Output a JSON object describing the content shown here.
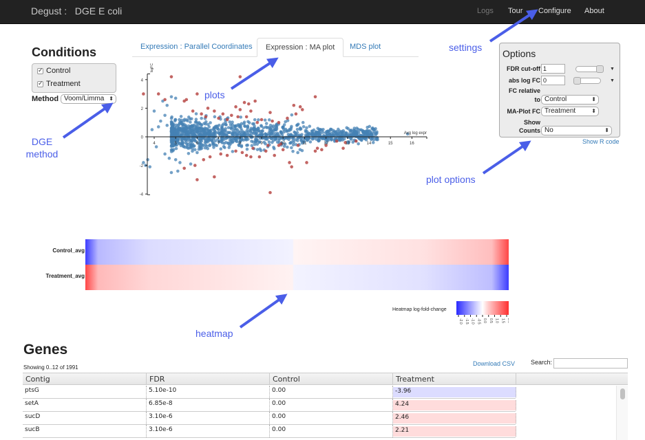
{
  "navbar": {
    "brand": "Degust :   DGE E coli",
    "links": [
      {
        "label": "Logs",
        "dim": true
      },
      {
        "label": "Tour",
        "dim": false
      },
      {
        "label": "Configure",
        "dim": false
      },
      {
        "label": "About",
        "dim": false
      }
    ]
  },
  "conditions": {
    "title": "Conditions",
    "items": [
      {
        "label": "Control",
        "checked": true
      },
      {
        "label": "Treatment",
        "checked": true
      }
    ],
    "method_label": "Method",
    "method_value": "Voom/Limma"
  },
  "tabs": [
    {
      "label": "Expression : Parallel Coordinates",
      "active": false
    },
    {
      "label": "Expression : MA plot",
      "active": true
    },
    {
      "label": "MDS plot",
      "active": false
    }
  ],
  "options": {
    "title": "Options",
    "fdr_label": "FDR cut-off",
    "fdr_value": "1",
    "fdr_slider_fraction": 1.0,
    "abslogfc_label": "abs log FC",
    "abslogfc_value": "0",
    "abslogfc_slider_fraction": 0.0,
    "fc_relative_label_1": "FC relative",
    "fc_relative_label_2": "to",
    "fc_relative_value": "Control",
    "maplot_fc_label": "MA-Plot FC",
    "maplot_fc_value": "Treatment",
    "show_counts_label_1": "Show",
    "show_counts_label_2": "Counts",
    "show_counts_value": "No",
    "show_r_code": "Show R code"
  },
  "colors": {
    "non_significant": "#4682b4",
    "significant": "#b94a48",
    "link": "#337ab7",
    "annotation": "#4a5ee8",
    "heatmap_low": "#2a2aff",
    "heatmap_high": "#ff3030"
  },
  "chart_data": {
    "type": "scatter",
    "title": "MA plot",
    "xlabel": "Avg log expr",
    "ylabel": "logFC",
    "xlim": [
      3.7,
      16.7
    ],
    "ylim": [
      -4.2,
      4.5
    ],
    "x_ticks": [
      4,
      5,
      6,
      7,
      8,
      9,
      10,
      11,
      12,
      13,
      14,
      15,
      16
    ],
    "y_ticks": [
      -4,
      -2,
      0,
      2,
      4
    ],
    "grid": false,
    "series": [
      {
        "name": "significant",
        "points": [
          [
            4.8,
            4.2
          ],
          [
            8.0,
            4.2
          ],
          [
            3.5,
            3.0
          ],
          [
            4.2,
            3.0
          ],
          [
            6.0,
            3.0
          ],
          [
            4.5,
            2.6
          ],
          [
            5.4,
            2.5
          ],
          [
            5.5,
            2.6
          ],
          [
            8.2,
            2.4
          ],
          [
            8.7,
            2.5
          ],
          [
            8.4,
            2.3
          ],
          [
            7.8,
            2.1
          ],
          [
            8.0,
            1.9
          ],
          [
            8.5,
            1.8
          ],
          [
            9.4,
            1.7
          ],
          [
            6.5,
            2.0
          ],
          [
            6.8,
            1.8
          ],
          [
            7.2,
            1.6
          ],
          [
            7.6,
            1.5
          ],
          [
            7.9,
            1.4
          ],
          [
            8.3,
            1.4
          ],
          [
            9.0,
            1.2
          ],
          [
            9.5,
            1.1
          ],
          [
            9.8,
            1.0
          ],
          [
            10.2,
            1.3
          ],
          [
            10.6,
            1.6
          ],
          [
            10.5,
            2.2
          ],
          [
            10.8,
            2.1
          ],
          [
            11.5,
            2.8
          ],
          [
            10.9,
            1.9
          ],
          [
            5.8,
            1.8
          ],
          [
            6.2,
            1.6
          ],
          [
            6.4,
            1.4
          ],
          [
            7.0,
            1.3
          ],
          [
            7.4,
            1.2
          ],
          [
            8.8,
            1.0
          ],
          [
            6.8,
            -2.8
          ],
          [
            6.0,
            -3.0
          ],
          [
            9.4,
            -3.9
          ],
          [
            10.3,
            -1.8
          ],
          [
            10.4,
            -2.1
          ],
          [
            11.1,
            -1.8
          ],
          [
            11.5,
            -1.0
          ],
          [
            11.8,
            -0.9
          ],
          [
            12.0,
            -0.6
          ],
          [
            12.5,
            -0.3
          ],
          [
            12.8,
            -0.8
          ],
          [
            12.9,
            -0.4
          ],
          [
            13.4,
            -0.3
          ],
          [
            7.8,
            -1.0
          ],
          [
            8.1,
            -1.1
          ],
          [
            8.5,
            -1.4
          ],
          [
            8.9,
            -1.4
          ],
          [
            9.2,
            -1.0
          ],
          [
            9.6,
            -1.3
          ],
          [
            9.8,
            -0.6
          ],
          [
            10.0,
            -0.9
          ],
          [
            7.4,
            -1.3
          ],
          [
            7.1,
            -1.2
          ],
          [
            6.6,
            -1.4
          ],
          [
            6.3,
            -1.6
          ],
          [
            5.9,
            -2.0
          ],
          [
            5.4,
            -2.2
          ],
          [
            9.9,
            -0.5
          ],
          [
            10.7,
            -0.6
          ],
          [
            11.6,
            -0.8
          ],
          [
            9.3,
            -0.6
          ],
          [
            8.6,
            -0.8
          ],
          [
            8.3,
            -1.3
          ]
        ]
      },
      {
        "name": "non-significant",
        "points": "dense cloud ~1900 genes, logFC centered near 0 spread ±1.3 for avg log expr 4.8-11, tapering to ±0.4 up to 14.4; outliers at 15.8, 0.2"
      }
    ]
  },
  "heatmap": {
    "rows": [
      "Control_avg",
      "Treatment_avg"
    ],
    "legend_title": "Heatmap log-fold-change",
    "legend_ticks": [
      "-2.0",
      "-1.5",
      "-1.0",
      "-0.5",
      "0.0",
      "0.5",
      "1.0",
      "1.5",
      "2.0"
    ]
  },
  "genes": {
    "title": "Genes",
    "showing": "Showing 0..12 of 1991",
    "download_label": "Download CSV",
    "search_label": "Search:",
    "search_value": "",
    "columns": [
      "Contig",
      "FDR",
      "Control",
      "Treatment",
      ""
    ],
    "rows": [
      {
        "contig": "ptsG",
        "fdr": "5.10e-10",
        "control": "0.00",
        "treatment": "-3.96",
        "sign": "neg"
      },
      {
        "contig": "setA",
        "fdr": "6.85e-8",
        "control": "0.00",
        "treatment": "4.24",
        "sign": "pos"
      },
      {
        "contig": "sucD",
        "fdr": "3.10e-6",
        "control": "0.00",
        "treatment": "2.46",
        "sign": "pos"
      },
      {
        "contig": "sucB",
        "fdr": "3.10e-6",
        "control": "0.00",
        "treatment": "2.21",
        "sign": "pos"
      }
    ]
  },
  "annotations": {
    "settings": "settings",
    "plots": "plots",
    "dge_method_1": "DGE",
    "dge_method_2": "method",
    "plot_options": "plot options",
    "heatmap": "heatmap"
  }
}
